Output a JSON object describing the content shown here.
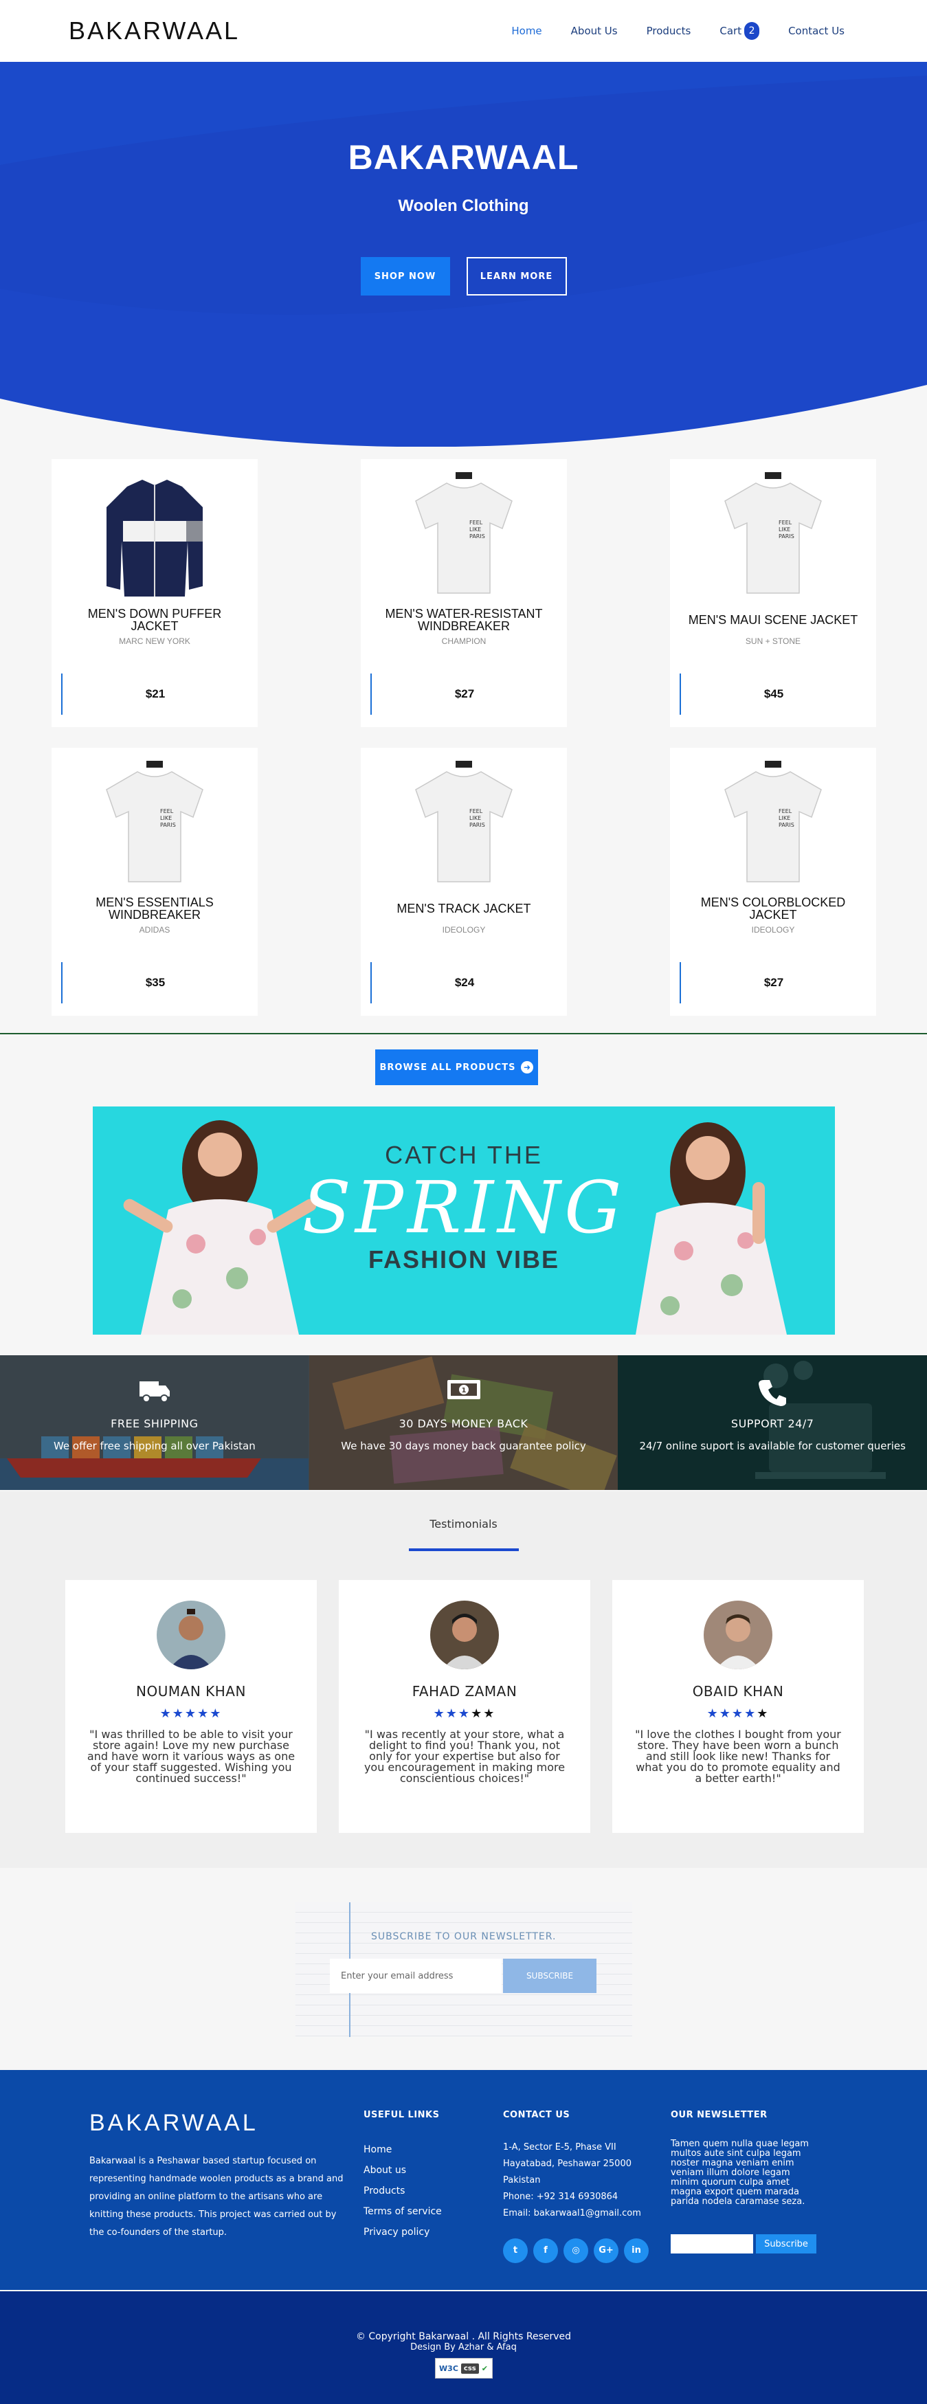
{
  "nav": {
    "brand": "BAKARWAAL",
    "links": [
      "Home",
      "About Us",
      "Products",
      "Cart",
      "Contact Us"
    ],
    "cart_count": "2"
  },
  "hero": {
    "title": "BAKARWAAL",
    "subtitle": "Woolen Clothing",
    "shop_btn": "SHOP NOW",
    "learn_btn": "LEARN MORE"
  },
  "products": [
    {
      "name": "MEN'S DOWN PUFFER JACKET",
      "maker": "MARC NEW YORK",
      "price": "$21",
      "image": "jacket"
    },
    {
      "name": "MEN'S WATER-RESISTANT WINDBREAKER",
      "maker": "CHAMPION",
      "price": "$27",
      "image": "tshirt"
    },
    {
      "name": "MEN'S MAUI SCENE JACKET",
      "maker": "SUN + STONE",
      "price": "$45",
      "image": "tshirt"
    },
    {
      "name": "MEN'S ESSENTIALS WINDBREAKER",
      "maker": "ADIDAS",
      "price": "$35",
      "image": "tshirt"
    },
    {
      "name": "MEN'S TRACK JACKET",
      "maker": "IDEOLOGY",
      "price": "$24",
      "image": "tshirt"
    },
    {
      "name": "MEN'S COLORBLOCKED JACKET",
      "maker": "IDEOLOGY",
      "price": "$27",
      "image": "tshirt"
    }
  ],
  "browse_btn": "BROWSE ALL PRODUCTS",
  "banner": {
    "line1": "CATCH THE",
    "line2": "SPRING",
    "line3": "FASHION VIBE",
    "color": "#27d7df"
  },
  "features": [
    {
      "icon": "truck-icon",
      "title": "FREE SHIPPING",
      "desc": "We offer free shipping all over Pakistan"
    },
    {
      "icon": "money-icon",
      "title": "30 DAYS MONEY BACK",
      "desc": "We have 30 days money back guarantee policy"
    },
    {
      "icon": "phone-icon",
      "title": "SUPPORT 24/7",
      "desc": "24/7 online suport is available for customer queries"
    }
  ],
  "testimonials": {
    "title": "Testimonials",
    "items": [
      {
        "name": "NOUMAN KHAN",
        "rating": 5,
        "quote": "\"I was thrilled to be able to visit your store again! Love my new purchase and have worn it various ways as one of your staff suggested. Wishing you continued success!\""
      },
      {
        "name": "FAHAD ZAMAN",
        "rating": 3,
        "quote": "\"I was recently at your store, what a delight to find you! Thank you, not only for your expertise but also for you encouragement in making more conscientious choices!\""
      },
      {
        "name": "OBAID KHAN",
        "rating": 4,
        "quote": "\"I love the clothes I bought from your store. They have been worn a bunch and still look like new! Thanks for what you do to promote equality and a better earth!\""
      }
    ]
  },
  "newsletter": {
    "title": "SUBSCRIBE TO OUR NEWSLETTER.",
    "placeholder": "Enter your email address",
    "button": "SUBSCRIBE"
  },
  "footer": {
    "brand": "BAKARWAAL",
    "about": "Bakarwaal is a Peshawar based startup focused on representing handmade woolen products as a brand and providing an online platform to the artisans who are knitting these products. This project was carried out by the co-founders of the startup.",
    "links_title": "USEFUL LINKS",
    "links": [
      "Home",
      "About us",
      "Products",
      "Terms of service",
      "Privacy policy"
    ],
    "contact_title": "CONTACT US",
    "contact": [
      "1-A, Sector E-5, Phase VII",
      "Hayatabad, Peshawar 25000",
      "Pakistan",
      "Phone: +92 314 6930864",
      "Email: bakarwaal1@gmail.com"
    ],
    "socials": [
      "twitter-icon",
      "facebook-icon",
      "instagram-icon",
      "google-plus-icon",
      "linkedin-icon"
    ],
    "nl_title": "OUR NEWSLETTER",
    "nl_text": "Tamen quem nulla quae legam multos aute sint culpa legam noster magna veniam enim veniam illum dolore legam minim quorum culpa amet magna export quem marada parida nodela caramase seza.",
    "nl_button": "Subscribe"
  },
  "copyright": {
    "line1": "© Copyright Bakarwaal . All Rights Reserved",
    "line2": "Design By Azhar & Afaq",
    "badge_w3c": "W3C",
    "badge_css": "css"
  }
}
